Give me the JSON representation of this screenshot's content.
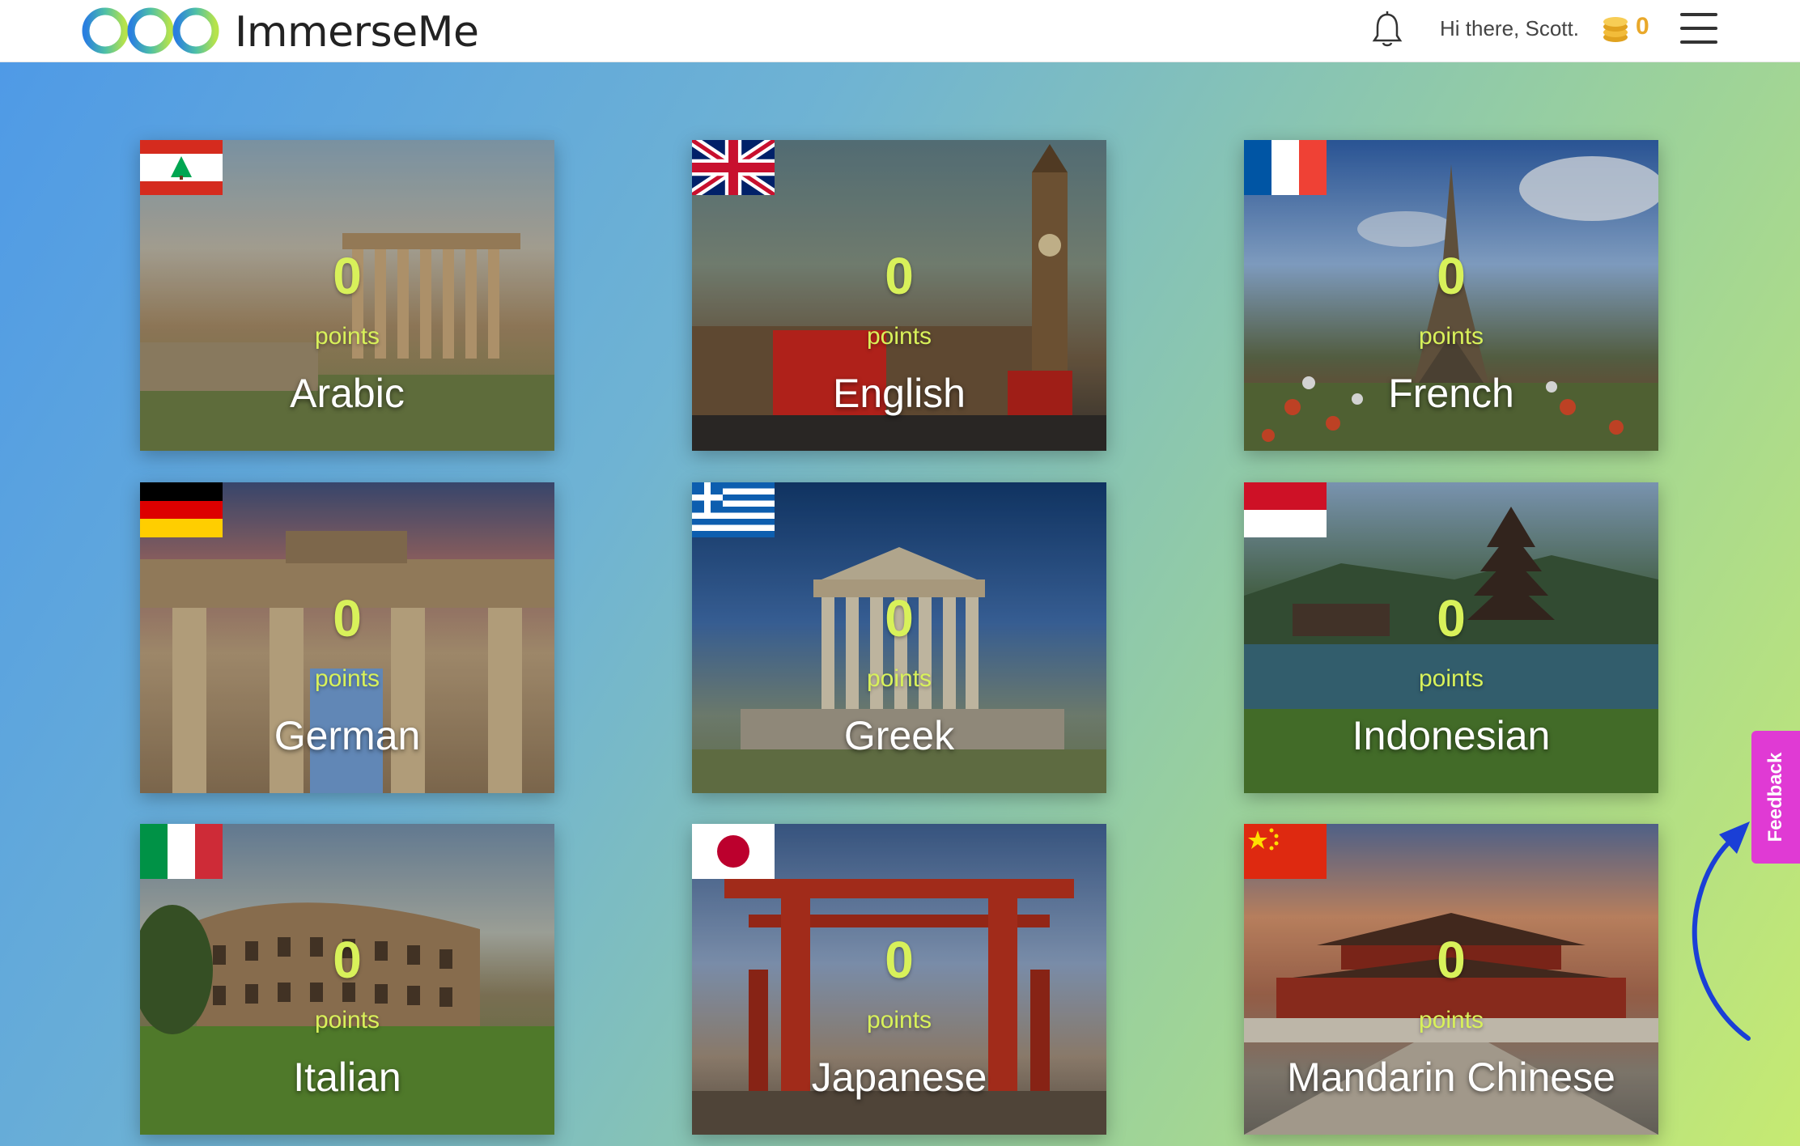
{
  "header": {
    "brand": "ImmerseMe",
    "greeting": "Hi there, Scott.",
    "coins": "0"
  },
  "languages": [
    {
      "name": "Arabic",
      "points": "0",
      "points_label": "points",
      "flag": "lebanon-flag-icon"
    },
    {
      "name": "English",
      "points": "0",
      "points_label": "points",
      "flag": "uk-flag-icon"
    },
    {
      "name": "French",
      "points": "0",
      "points_label": "points",
      "flag": "france-flag-icon"
    },
    {
      "name": "German",
      "points": "0",
      "points_label": "points",
      "flag": "germany-flag-icon"
    },
    {
      "name": "Greek",
      "points": "0",
      "points_label": "points",
      "flag": "greece-flag-icon"
    },
    {
      "name": "Indonesian",
      "points": "0",
      "points_label": "points",
      "flag": "indonesia-flag-icon"
    },
    {
      "name": "Italian",
      "points": "0",
      "points_label": "points",
      "flag": "italy-flag-icon"
    },
    {
      "name": "Japanese",
      "points": "0",
      "points_label": "points",
      "flag": "japan-flag-icon"
    },
    {
      "name": "Mandarin Chinese",
      "points": "0",
      "points_label": "points",
      "flag": "china-flag-icon"
    }
  ],
  "feedback": {
    "label": "Feedback"
  },
  "colors": {
    "points": "#d8f15a",
    "feedback_tab": "#e03ad4",
    "coins": "#e9a82a",
    "annotation_arrow": "#1a3fd6"
  }
}
